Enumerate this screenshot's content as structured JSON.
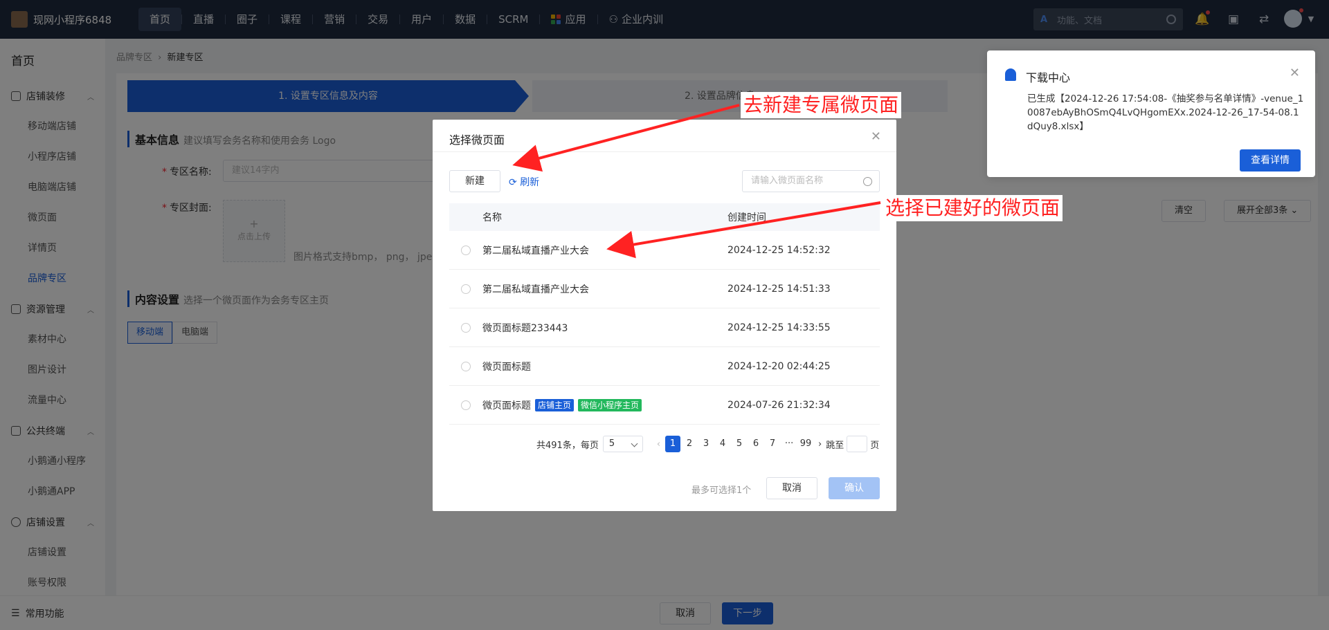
{
  "topnav": {
    "brand": "现网小程序6848",
    "menu": [
      "首页",
      "直播",
      "圈子",
      "课程",
      "营销",
      "交易",
      "用户",
      "数据",
      "SCRM",
      "应用",
      "企业内训"
    ],
    "search_placeholder": "功能、文档"
  },
  "sidebar": {
    "title": "首页",
    "groups": [
      {
        "label": "店铺装修",
        "items": [
          "移动端店铺",
          "小程序店铺",
          "电脑端店铺",
          "微页面",
          "详情页",
          "品牌专区"
        ]
      },
      {
        "label": "资源管理",
        "items": [
          "素材中心",
          "图片设计",
          "流量中心"
        ]
      },
      {
        "label": "公共终端",
        "items": [
          "小鹅通小程序",
          "小鹅通APP"
        ]
      },
      {
        "label": "店铺设置",
        "items": [
          "店铺设置",
          "账号权限"
        ]
      }
    ],
    "footer": "常用功能"
  },
  "breadcrumb": {
    "parent": "品牌专区",
    "sep": "›",
    "current": "新建专区"
  },
  "steps": {
    "step1": "1. 设置专区信息及内容",
    "step2": "2. 设置品牌信息"
  },
  "form": {
    "basic_title": "基本信息",
    "basic_hint": "建议填写会务名称和使用会务 Logo",
    "name_label": "专区名称:",
    "name_placeholder": "建议14字内",
    "cover_label": "专区封面:",
    "upload_plus": "+",
    "upload_text": "点击上传",
    "cover_hint": "图片格式支持bmp， png， jpeg",
    "content_title": "内容设置",
    "content_hint": "选择一个微页面作为会务专区主页",
    "tab_mobile": "移动端",
    "tab_pc": "电脑端",
    "clear_btn": "清空",
    "expand_btn": "展开全部3条"
  },
  "bottom": {
    "cancel": "取消",
    "next": "下一步"
  },
  "modal": {
    "title": "选择微页面",
    "new_btn": "新建",
    "refresh": "刷新",
    "search_placeholder": "请输入微页面名称",
    "col_name": "名称",
    "col_time": "创建时间",
    "rows": [
      {
        "name": "第二届私域直播产业大会",
        "time": "2024-12-25 14:52:32",
        "tags": []
      },
      {
        "name": "第二届私域直播产业大会",
        "time": "2024-12-25 14:51:33",
        "tags": []
      },
      {
        "name": "微页面标题233443",
        "time": "2024-12-25 14:33:55",
        "tags": []
      },
      {
        "name": "微页面标题",
        "time": "2024-12-20 02:44:25",
        "tags": []
      },
      {
        "name": "微页面标题",
        "time": "2024-07-26 21:32:34",
        "tags": [
          {
            "text": "店铺主页",
            "color": "#1a5fd8"
          },
          {
            "text": "微信小程序主页",
            "color": "#22b85c"
          }
        ]
      }
    ],
    "pager": {
      "total": "共491条，每页",
      "size": "5",
      "pages": [
        "1",
        "2",
        "3",
        "4",
        "5",
        "6",
        "7",
        "···",
        "99"
      ],
      "jump_label": "跳至",
      "page_unit": "页"
    },
    "max_hint": "最多可选择1个",
    "cancel": "取消",
    "confirm": "确认"
  },
  "notify": {
    "title": "下载中心",
    "message": "已生成【2024-12-26 17:54:08-《抽奖参与名单详情》-venue_10087ebAyBhOSmQ4LvQHgomEXx.2024-12-26_17-54-08.1dQuy8.xlsx】",
    "button": "查看详情"
  },
  "annotations": {
    "new_page": "去新建专属微页面",
    "choose_page": "选择已建好的微页面"
  },
  "colors": {
    "accent": "#1a5fd8",
    "annotation": "#ff2222",
    "nav_bg": "#1f2b3e"
  }
}
